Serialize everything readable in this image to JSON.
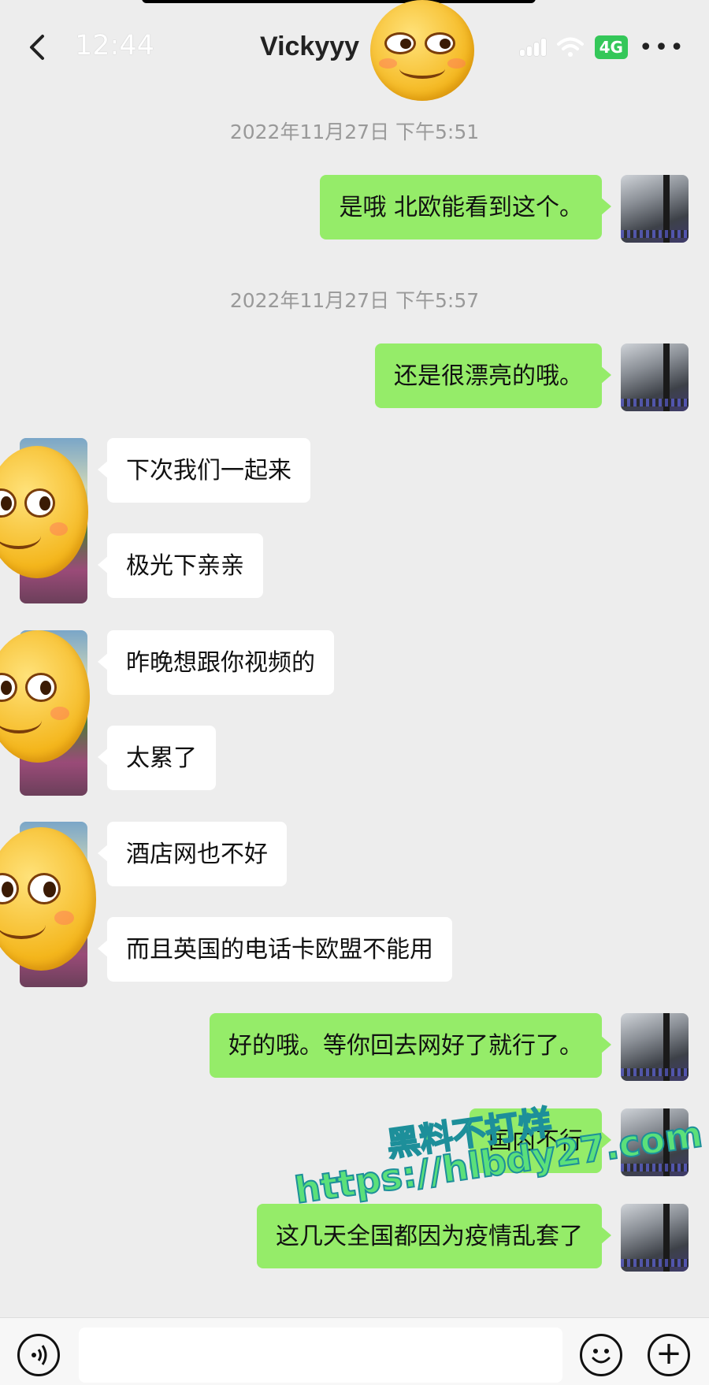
{
  "status_bar": {
    "time": "12:44",
    "network": "4G"
  },
  "header": {
    "back_icon": "chevron-left-icon",
    "title": "Vickyyy",
    "more_icon": "more-dots-icon",
    "more_label": "•••"
  },
  "messages": [
    {
      "type": "timestamp",
      "text": "2022年11月27日 下午5:51"
    },
    {
      "type": "me",
      "text": "是哦 北欧能看到这个。"
    },
    {
      "type": "timestamp",
      "text": "2022年11月27日 下午5:57"
    },
    {
      "type": "me",
      "text": "还是很漂亮的哦。"
    },
    {
      "type": "them",
      "text": "下次我们一起来"
    },
    {
      "type": "them",
      "text": "极光下亲亲"
    },
    {
      "type": "them",
      "text": "昨晚想跟你视频的"
    },
    {
      "type": "them",
      "text": "太累了"
    },
    {
      "type": "them",
      "text": "酒店网也不好"
    },
    {
      "type": "them",
      "text": "而且英国的电话卡欧盟不能用"
    },
    {
      "type": "me",
      "text": "好的哦。等你回去网好了就行了。"
    },
    {
      "type": "me",
      "text": "国内不行"
    },
    {
      "type": "me",
      "text": "这几天全国都因为疫情乱套了"
    }
  ],
  "watermark": {
    "line1": "黑料不打烊",
    "line2": "https://hlbdy27.com"
  },
  "input_bar": {
    "voice_icon": "voice-icon",
    "emoji_icon": "emoji-icon",
    "plus_icon": "plus-icon",
    "plus_label": "+"
  },
  "colors": {
    "background": "#ededed",
    "my_bubble": "#95ec69",
    "their_bubble": "#ffffff",
    "timestamp_text": "#999999"
  }
}
